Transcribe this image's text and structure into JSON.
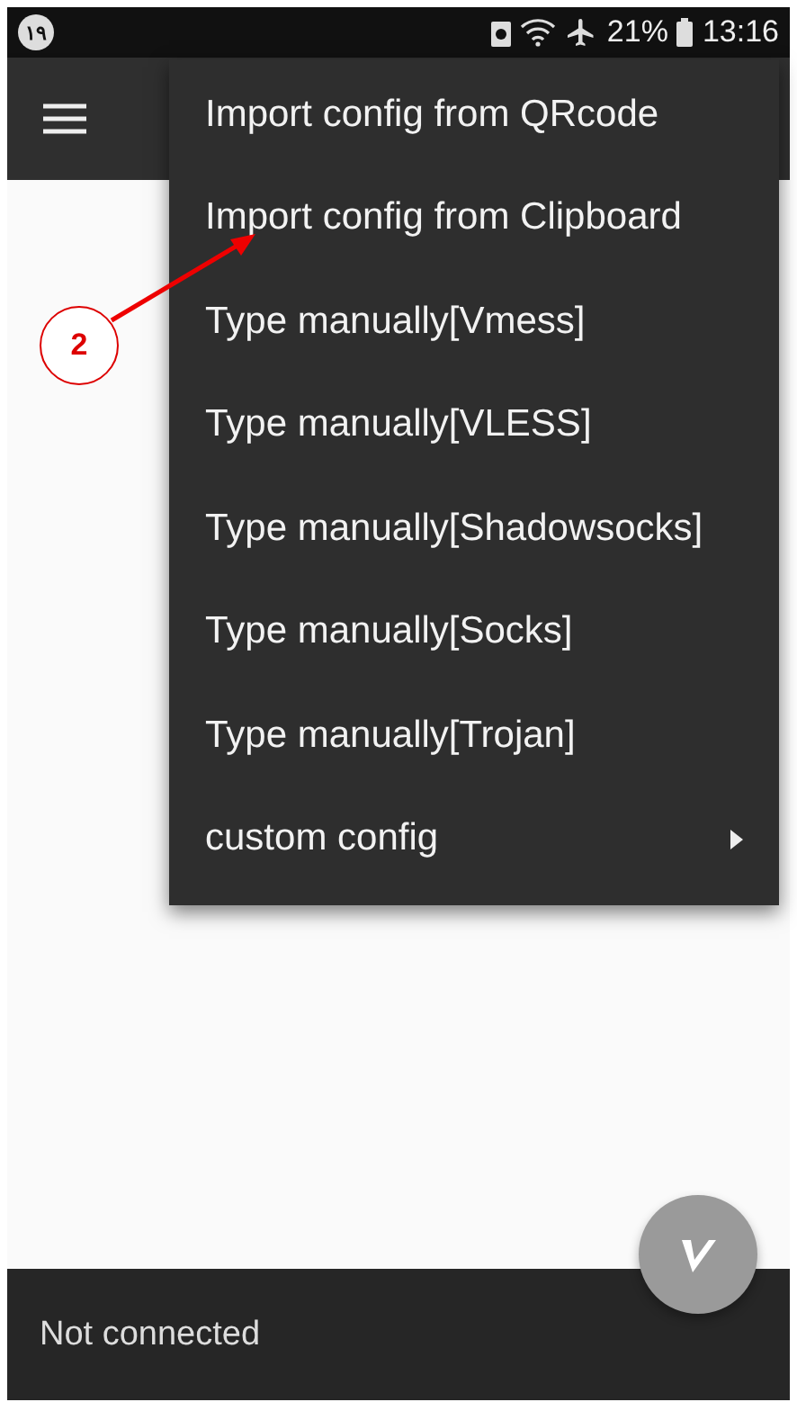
{
  "status_bar": {
    "notification_badge": "١٩",
    "battery_percent": "21%",
    "time": "13:16"
  },
  "menu": {
    "items": [
      {
        "label": "Import config from QRcode",
        "kind": "action"
      },
      {
        "label": "Import config from Clipboard",
        "kind": "action"
      },
      {
        "label": "Type manually[Vmess]",
        "kind": "action"
      },
      {
        "label": "Type manually[VLESS]",
        "kind": "action"
      },
      {
        "label": "Type manually[Shadowsocks]",
        "kind": "action"
      },
      {
        "label": "Type manually[Socks]",
        "kind": "action"
      },
      {
        "label": "Type manually[Trojan]",
        "kind": "action"
      },
      {
        "label": "custom config",
        "kind": "submenu"
      }
    ]
  },
  "annotation": {
    "label": "2"
  },
  "bottom_bar": {
    "status": "Not connected"
  }
}
